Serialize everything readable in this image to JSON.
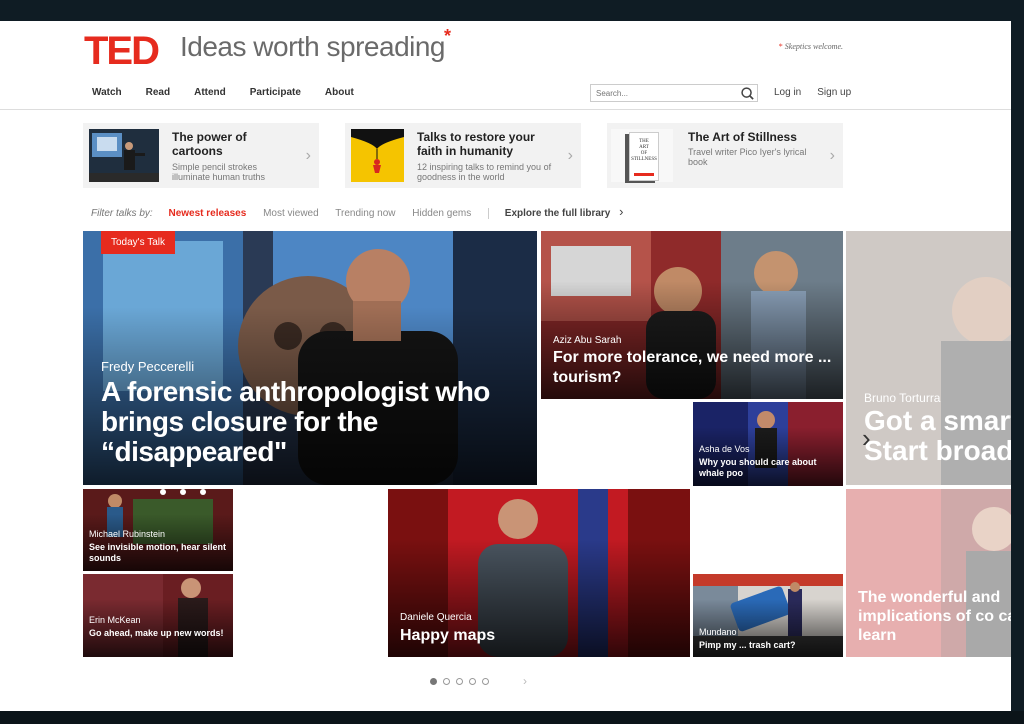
{
  "brand": {
    "logo": "TED",
    "tagline": "Ideas worth spreading",
    "star": "*",
    "note": "Skeptics welcome."
  },
  "nav": [
    "Watch",
    "Read",
    "Attend",
    "Participate",
    "About"
  ],
  "search": {
    "placeholder": "Search..."
  },
  "auth": {
    "login": "Log in",
    "signup": "Sign up"
  },
  "features": [
    {
      "title": "The power of cartoons",
      "desc": "Simple pencil strokes illuminate human truths"
    },
    {
      "title": "Talks to restore your faith in humanity",
      "desc": "12 inspiring talks to remind you of goodness in the world"
    },
    {
      "title": "The Art of Stillness",
      "desc": "Travel writer Pico Iyer's lyrical book",
      "book_cover": [
        "THE",
        "ART",
        "OF",
        "STILLNESS"
      ]
    }
  ],
  "filter": {
    "label": "Filter talks by:",
    "options": [
      "Newest releases",
      "Most viewed",
      "Trending now",
      "Hidden gems"
    ],
    "active": "Newest releases",
    "explore": "Explore the full library"
  },
  "tiles": {
    "main": {
      "badge": "Today's Talk",
      "speaker": "Fredy Peccerelli",
      "title": "A forensic anthropologist who brings closure for the “disappeared\""
    },
    "tolerance": {
      "speaker": "Aziz Abu Sarah",
      "title": "For more tolerance, we need more ... tourism?"
    },
    "side": {
      "speaker": "Bruno Torturra",
      "title": "Got a smartphone? Start broadcasting"
    },
    "whale": {
      "speaker": "Asha de Vos",
      "title": "Why you should care about whale poo"
    },
    "motion": {
      "speaker": "Michael Rubinstein",
      "title": "See invisible motion, hear silent sounds"
    },
    "erin": {
      "speaker": "Erin McKean",
      "title": "Go ahead, make up new words!"
    },
    "maps": {
      "speaker": "Daniele Quercia",
      "title": "Happy maps"
    },
    "trash": {
      "speaker": "Mundano",
      "title": "Pimp my ... trash cart?"
    },
    "side2": {
      "title": "The wonderful and implications of co can learn"
    }
  },
  "pager": {
    "pages": 5,
    "current": 1
  },
  "colors": {
    "accent": "#e62b1e",
    "frame": "#0f1c24"
  }
}
